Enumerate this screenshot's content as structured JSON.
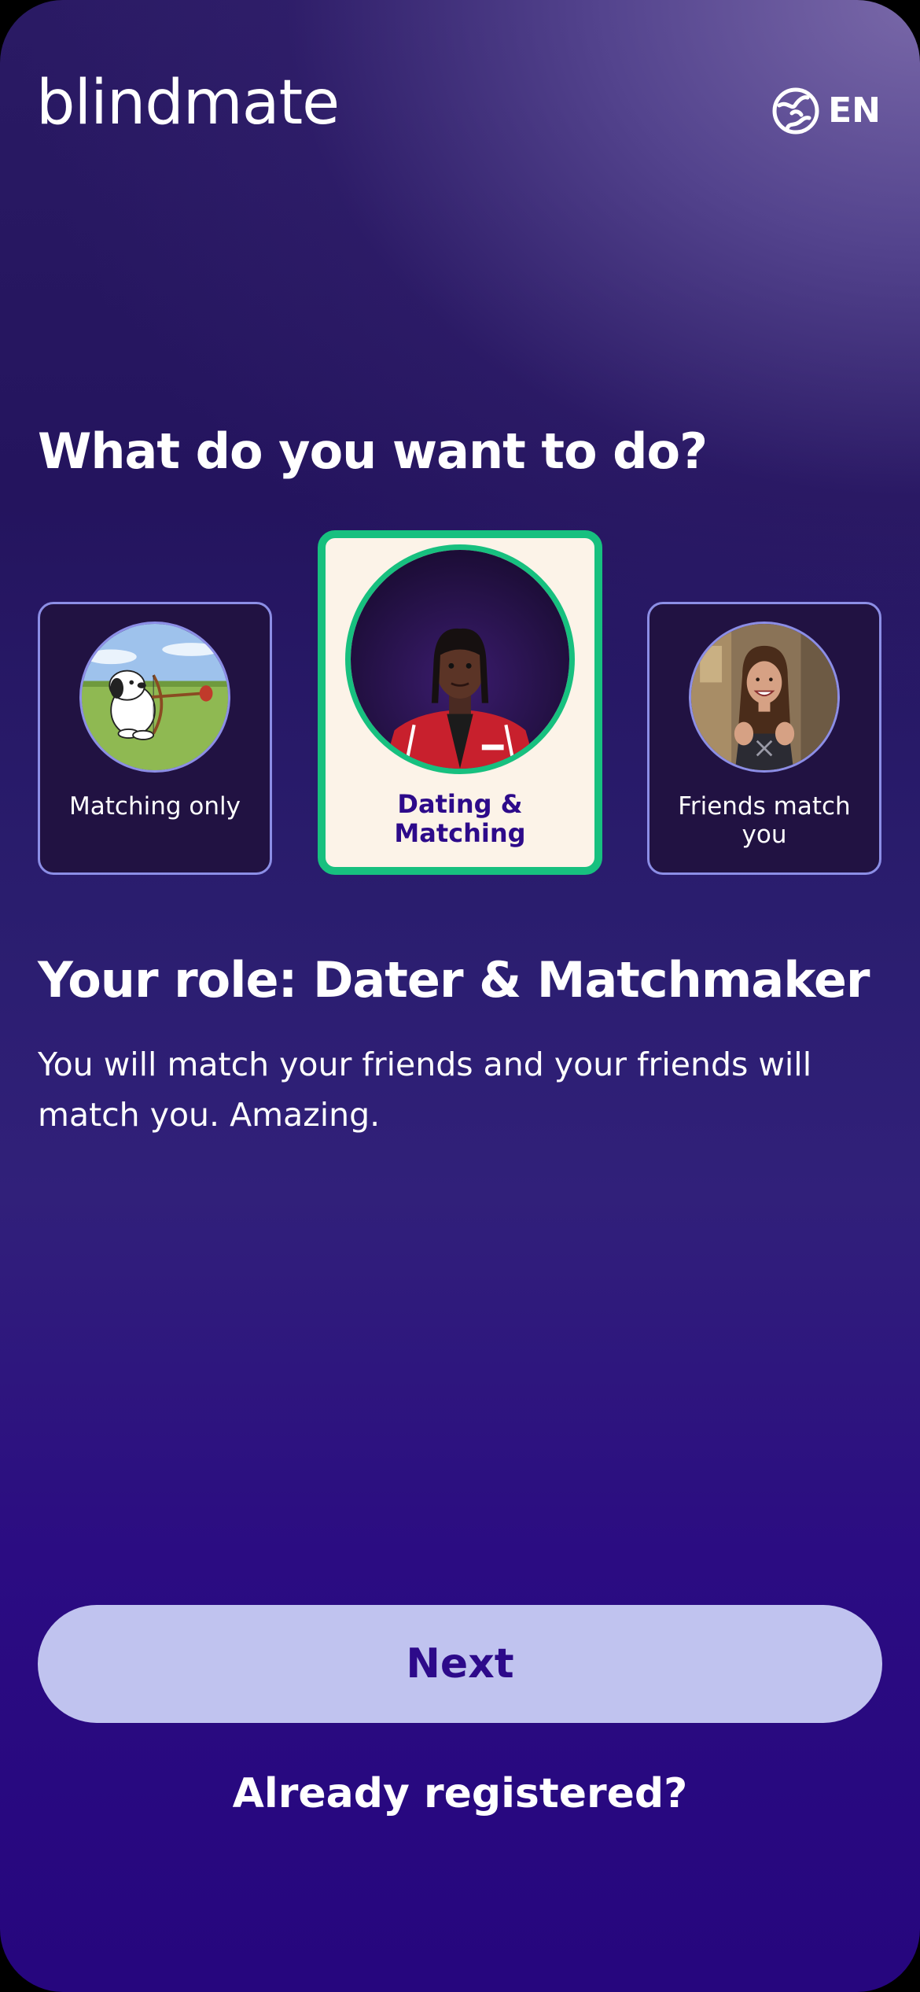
{
  "header": {
    "brand": "blindmate",
    "language_icon": "globe-icon",
    "language": "EN"
  },
  "question": "What do you want to do?",
  "options": [
    {
      "label": "Matching only",
      "image": "snoopy-cupid-illustration",
      "selected": false
    },
    {
      "label": "Dating & Matching",
      "image": "man-in-red-jacket-photo",
      "selected": true
    },
    {
      "label": "Friends match you",
      "image": "excited-woman-photo",
      "selected": false
    }
  ],
  "role": {
    "title": "Your role: Dater & Matchmaker",
    "description": "You will match your friends and your friends will match you. Amazing."
  },
  "actions": {
    "next": "Next",
    "already_registered": "Already registered?"
  },
  "colors": {
    "background_top": "#2a1a64",
    "background_bottom": "#26067e",
    "accent_green": "#17c07f",
    "card_border": "#8c8ee6",
    "selected_card_bg": "#fcf3e8",
    "button_bg": "#c0c3ef",
    "button_text": "#2d0a8a"
  }
}
